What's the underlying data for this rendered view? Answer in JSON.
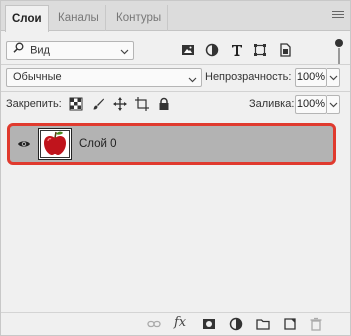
{
  "tabs": [
    {
      "label": "Слои",
      "active": true
    },
    {
      "label": "Каналы",
      "active": false
    },
    {
      "label": "Контуры",
      "active": false
    }
  ],
  "filter": {
    "selected": "Вид",
    "icon": "search-icon"
  },
  "filter_icons": [
    "image-filter-icon",
    "adjustment-filter-icon",
    "type-filter-icon",
    "shape-filter-icon",
    "smart-object-filter-icon"
  ],
  "blend": {
    "mode": "Обычные",
    "opacity_label": "Непрозрачность:",
    "opacity": "100%"
  },
  "lock": {
    "label": "Закрепить:",
    "fill_label": "Заливка:",
    "fill": "100%"
  },
  "layers": [
    {
      "name": "Слой 0",
      "visible": true,
      "selected": true
    }
  ],
  "accent_colors": {
    "highlight_border": "#e03a2e",
    "selected_row": "#b3b3b3"
  }
}
